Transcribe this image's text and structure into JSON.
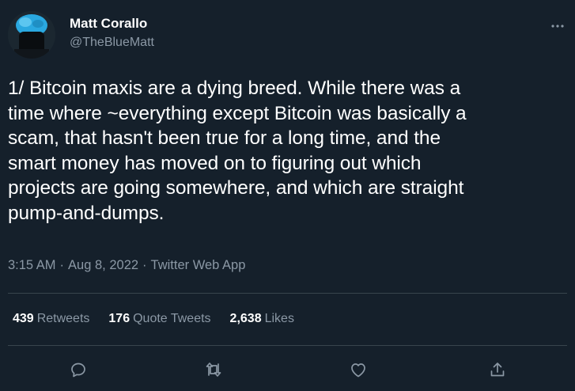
{
  "author": {
    "name": "Matt Corallo",
    "handle": "@TheBlueMatt"
  },
  "tweet": {
    "text": "1/ Bitcoin maxis are a dying breed. While there was a\ntime where ~everything except Bitcoin was basically a\nscam, that hasn't been true for a long time, and the\nsmart money has moved on to figuring out which\nprojects are going somewhere, and which are straight\npump-and-dumps.",
    "time": "3:15 AM",
    "date": "Aug 8, 2022",
    "source": "Twitter Web App",
    "separator": "·"
  },
  "stats": {
    "retweets_count": "439",
    "retweets_label": "Retweets",
    "quotes_count": "176",
    "quotes_label": "Quote Tweets",
    "likes_count": "2,638",
    "likes_label": "Likes"
  },
  "icons": {
    "more": "more-horizontal-icon",
    "reply": "reply-icon",
    "retweet": "retweet-icon",
    "like": "heart-icon",
    "share": "share-icon"
  },
  "colors": {
    "background": "#15202b",
    "text_primary": "#ffffff",
    "text_secondary": "#8b98a5",
    "divider": "#38444d",
    "avatar_hair": "#2aa8e0"
  }
}
